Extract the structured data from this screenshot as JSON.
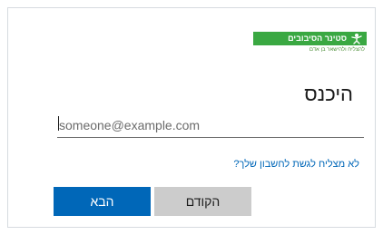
{
  "logo": {
    "name": "סטינר הסיבובים",
    "tagline": "להצליח ולהישאר בן אדם",
    "brand_color": "#3aa842",
    "icon": "figure-icon"
  },
  "signin": {
    "title": "היכנס",
    "email_placeholder": "someone@example.com",
    "cant_access_link": "לא מצליח לגשת לחשבון שלך?"
  },
  "buttons": {
    "back_label": "הקודם",
    "next_label": "הבא",
    "primary_color": "#0067b8",
    "secondary_color": "#cccccc"
  }
}
